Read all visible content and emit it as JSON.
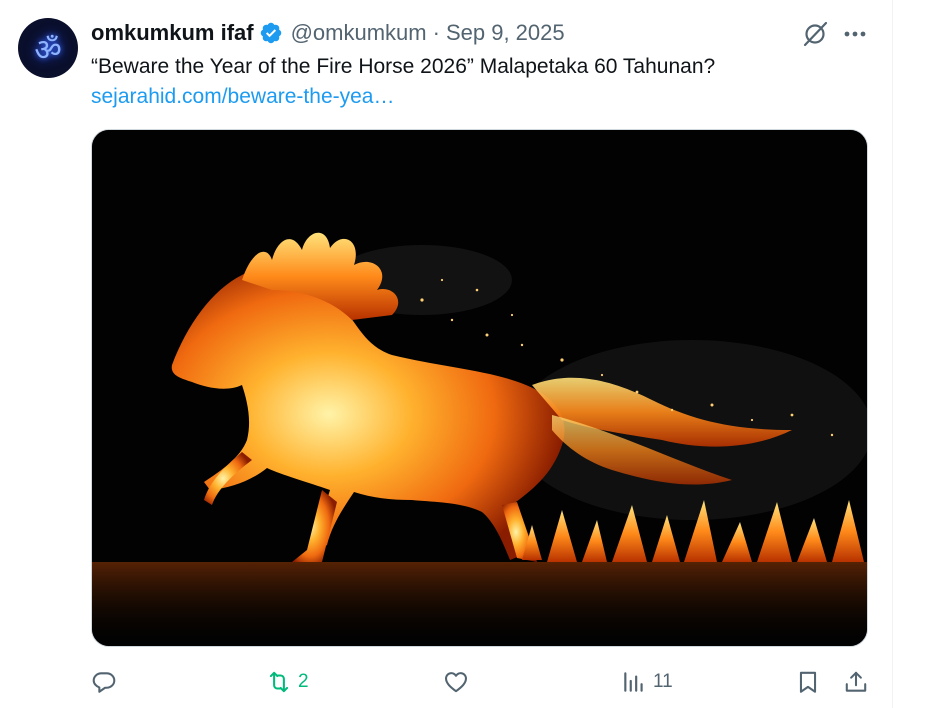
{
  "tweet": {
    "author": {
      "display_name": "omkumkum ifaf",
      "handle": "@omkumkum",
      "avatar_glyph": "ॐ",
      "verified": true
    },
    "separator": "·",
    "date": "Sep 9, 2025",
    "text": "“Beware the Year of the Fire Horse 2026” Malapetaka 60 Tahunan?",
    "link_text": "sejarahid.com/beware-the-yea…",
    "media": {
      "description_icon": "fire-horse-image"
    },
    "actions": {
      "reply": {
        "icon": "reply-icon",
        "count": ""
      },
      "retweet": {
        "icon": "retweet-icon",
        "count": "2",
        "active_color": "#00ba7c"
      },
      "like": {
        "icon": "heart-icon",
        "count": ""
      },
      "views": {
        "icon": "views-icon",
        "count": "11"
      },
      "bookmark": {
        "icon": "bookmark-icon"
      },
      "share": {
        "icon": "share-icon"
      }
    }
  },
  "colors": {
    "text_primary": "#0f1419",
    "text_secondary": "#536471",
    "link": "#1d9bf0",
    "verified": "#1d9bf0"
  }
}
